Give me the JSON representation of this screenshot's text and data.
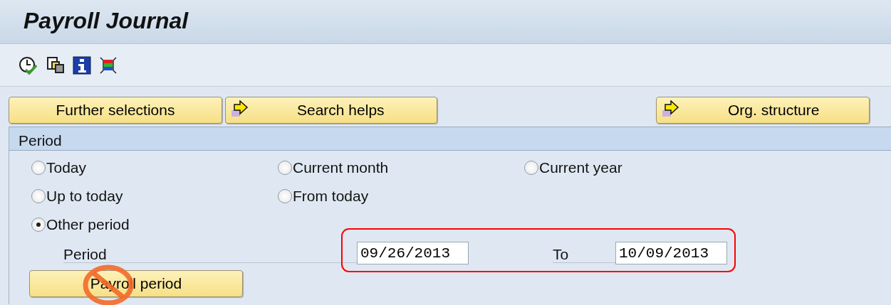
{
  "window": {
    "title": "Payroll Journal"
  },
  "buttons": [
    {
      "label": "Further selections",
      "kind": "plain"
    },
    {
      "label": "Search helps",
      "kind": "arrow"
    },
    {
      "label": "Org. structure",
      "kind": "arrow"
    }
  ],
  "section": {
    "title": "Period",
    "rows": [
      [
        {
          "label": "Today",
          "selected": false
        },
        {
          "label": "Current month",
          "selected": false
        },
        {
          "label": "Current year",
          "selected": false
        }
      ],
      [
        {
          "label": "Up to today",
          "selected": false
        },
        {
          "label": "From today",
          "selected": false
        }
      ],
      [
        {
          "label": "Other period",
          "selected": true
        }
      ]
    ]
  },
  "period": {
    "label": "Period",
    "from": "09/26/2013",
    "to_label": "To",
    "to": "10/09/2013",
    "highlighted": true
  },
  "payroll_button": {
    "label": "Payroll period",
    "blocked": true
  }
}
